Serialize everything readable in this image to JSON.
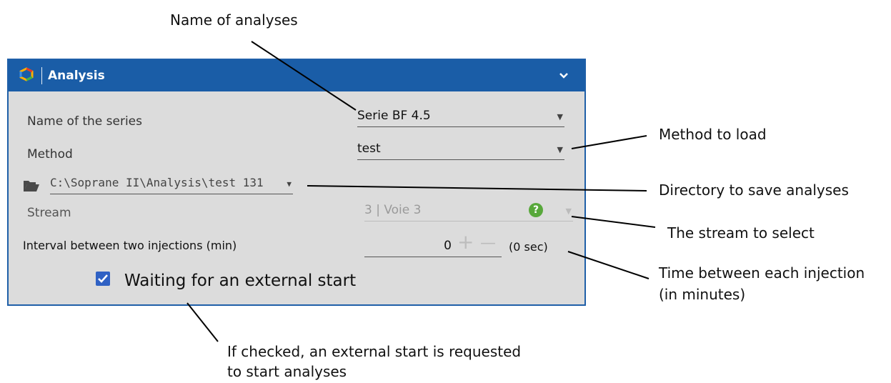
{
  "callouts": {
    "name_of_analyses": "Name of analyses",
    "method_to_load": "Method to load",
    "directory": "Directory to save analyses",
    "stream": "The stream to select",
    "time_line1": "Time between each injection",
    "time_line2": "(in minutes)",
    "external_line1": "If checked, an external start is requested",
    "external_line2": "to start analyses"
  },
  "panel": {
    "title": "Analysis",
    "series_label": "Name of the series",
    "series_value": "Serie BF 4.5",
    "method_label": "Method",
    "method_value": "test",
    "directory_value": "C:\\Soprane II\\Analysis\\test 131",
    "stream_label": "Stream",
    "stream_value": "3 | Voie 3",
    "help_glyph": "?",
    "interval_label": "Interval between two injections (min)",
    "interval_value": "0",
    "interval_plus": "+",
    "interval_minus": "—",
    "interval_seconds": "(0 sec)",
    "external_start_label": "Waiting for an external start",
    "external_start_checked": true
  },
  "icons": {
    "logo": "app-logo-icon",
    "collapse": "chevron-down-icon",
    "folder": "folder-icon",
    "dropdown": "caret-down-icon",
    "help": "help-icon",
    "check": "checkbox-checked-icon"
  },
  "colors": {
    "header": "#1a5da7",
    "panel_bg": "#dcdcdc",
    "help_green": "#58a83b",
    "checkbox_blue": "#2f61c4"
  }
}
